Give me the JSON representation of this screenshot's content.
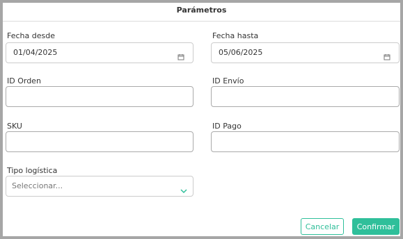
{
  "dialog": {
    "title": "Parámetros",
    "fields": {
      "fecha_desde": {
        "label": "Fecha desde",
        "value": "01/04/2025",
        "icon": "calendar-icon"
      },
      "fecha_hasta": {
        "label": "Fecha hasta",
        "value": "05/06/2025",
        "icon": "calendar-icon"
      },
      "id_orden": {
        "label": "ID Orden",
        "value": ""
      },
      "id_envio": {
        "label": "ID Envío",
        "value": ""
      },
      "sku": {
        "label": "SKU",
        "value": ""
      },
      "id_pago": {
        "label": "ID Pago",
        "value": ""
      },
      "tipo_logistica": {
        "label": "Tipo logística",
        "placeholder": "Seleccionar...",
        "icon": "chevron-down-icon"
      }
    },
    "buttons": {
      "cancel": "Cancelar",
      "confirm": "Confirmar"
    },
    "colors": {
      "accent": "#2fbf9a",
      "border": "#a6a6a6"
    }
  }
}
